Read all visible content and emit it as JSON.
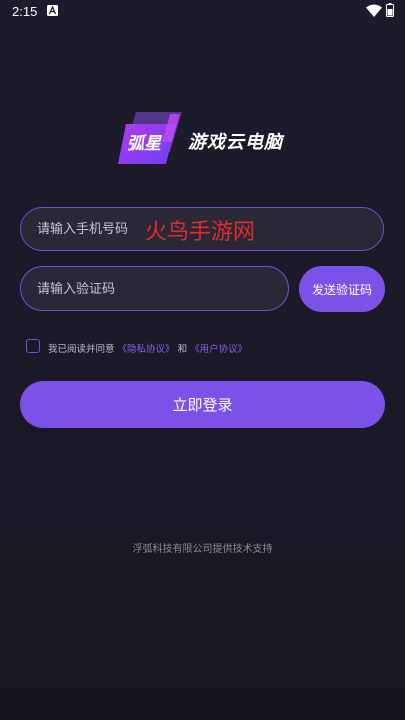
{
  "status_bar": {
    "time": "2:15"
  },
  "logo": {
    "mark_text": "弧星",
    "app_name": "游戏云电脑"
  },
  "phone": {
    "placeholder": "请输入手机号码"
  },
  "watermark": {
    "text": "火鸟手游网"
  },
  "code": {
    "placeholder": "请输入验证码",
    "send_label": "发送验证码"
  },
  "agreement": {
    "prefix": "我已阅读并同意",
    "privacy_link": "《隐私协议》",
    "conjunction": "和",
    "user_link": "《用户协议》",
    "checked": false
  },
  "login": {
    "label": "立即登录"
  },
  "footer": {
    "text": "浮弧科技有限公司提供技术支持"
  },
  "colors": {
    "accent": "#7a52e8",
    "border": "#7b4ad8",
    "background": "#1e1c2a",
    "watermark": "#e22b2b"
  }
}
